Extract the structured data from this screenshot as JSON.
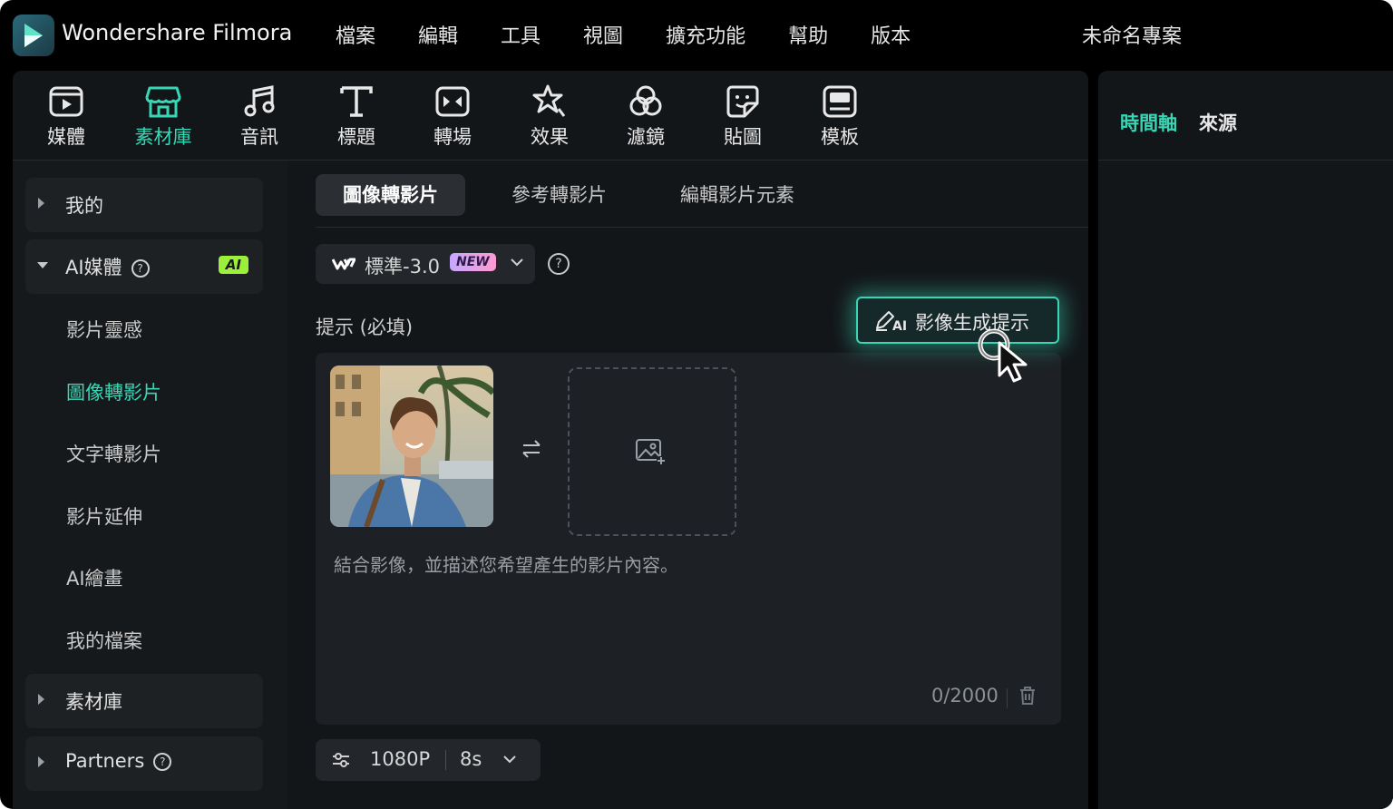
{
  "app": {
    "title": "Wondershare Filmora",
    "project_name": "未命名專案"
  },
  "menu": [
    "檔案",
    "編輯",
    "工具",
    "視圖",
    "擴充功能",
    "幫助",
    "版本"
  ],
  "toolbar": {
    "items": [
      {
        "label": "媒體",
        "icon": "media-icon"
      },
      {
        "label": "素材庫",
        "icon": "store-icon",
        "active": true
      },
      {
        "label": "音訊",
        "icon": "music-note-icon"
      },
      {
        "label": "標題",
        "icon": "title-t-icon"
      },
      {
        "label": "轉場",
        "icon": "transition-icon"
      },
      {
        "label": "效果",
        "icon": "effects-star-icon"
      },
      {
        "label": "濾鏡",
        "icon": "filter-icon"
      },
      {
        "label": "貼圖",
        "icon": "sticker-icon"
      },
      {
        "label": "模板",
        "icon": "template-icon"
      }
    ]
  },
  "right_panel": {
    "tabs": [
      "時間軸",
      "來源"
    ],
    "active_tab": "時間軸"
  },
  "sidebar": {
    "my": "我的",
    "ai_media": "AI媒體",
    "ai_badge": "AI",
    "ai_items": [
      "影片靈感",
      "圖像轉影片",
      "文字轉影片",
      "影片延伸",
      "AI繪畫",
      "我的檔案"
    ],
    "active_item": "圖像轉影片",
    "library": "素材庫",
    "partners": "Partners"
  },
  "content": {
    "tabs": [
      "圖像轉影片",
      "參考轉影片",
      "編輯影片元素"
    ],
    "active_tab": "圖像轉影片",
    "model": {
      "name": "標準-3.0",
      "badge": "NEW"
    },
    "prompt_label": "提示 (必填)",
    "generate_prompt_button": "影像生成提示",
    "placeholder": "結合影像，並描述您希望產生的影片內容。",
    "char_count": "0/2000",
    "resolution": "1080P",
    "duration": "8s"
  },
  "colors": {
    "accent": "#38d6b5",
    "panel": "#131619",
    "ai_badge": "#9cf03a"
  }
}
